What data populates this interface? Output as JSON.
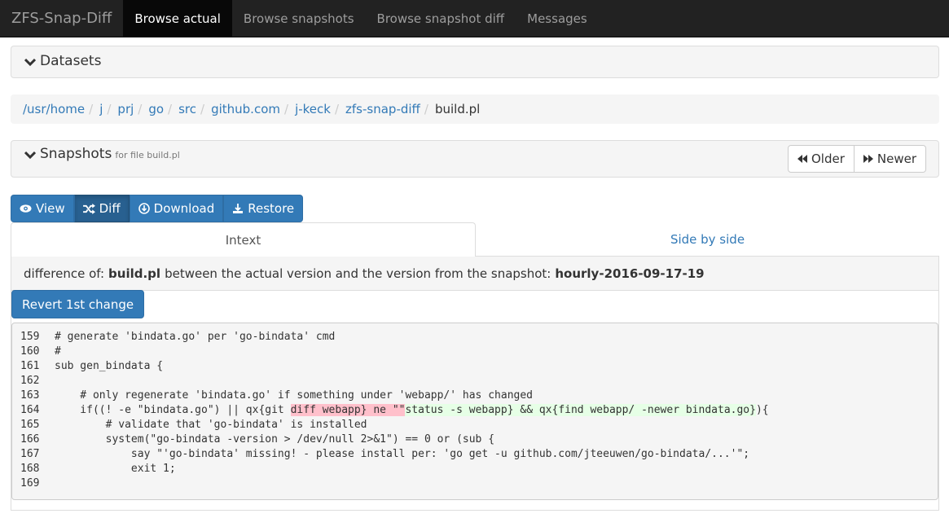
{
  "navbar": {
    "brand": "ZFS-Snap-Diff",
    "items": [
      {
        "label": "Browse actual",
        "active": true
      },
      {
        "label": "Browse snapshots",
        "active": false
      },
      {
        "label": "Browse snapshot diff",
        "active": false
      },
      {
        "label": "Messages",
        "active": false
      }
    ]
  },
  "datasets": {
    "title": "Datasets",
    "icon": "chevron-down-icon"
  },
  "breadcrumb": [
    "/usr/home",
    "j",
    "prj",
    "go",
    "src",
    "github.com",
    "j-keck",
    "zfs-snap-diff",
    "build.pl"
  ],
  "snapshots": {
    "title": "Snapshots",
    "subtitle": "for file build.pl",
    "older_label": "Older",
    "newer_label": "Newer"
  },
  "actions": {
    "view_label": "View",
    "diff_label": "Diff",
    "download_label": "Download",
    "restore_label": "Restore"
  },
  "tabs": [
    {
      "label": "Intext",
      "active": true
    },
    {
      "label": "Side by side",
      "active": false
    }
  ],
  "diff": {
    "prefix": "difference of:",
    "file": "build.pl",
    "middle": "between the actual version and the version from the snapshot:",
    "snapshot": "hourly-2016-09-17-19",
    "revert_label": "Revert 1st change",
    "lines": [
      {
        "num": "159",
        "parts": [
          {
            "text": "# generate 'bindata.go' per 'go-bindata' cmd",
            "type": "normal"
          }
        ]
      },
      {
        "num": "160",
        "parts": [
          {
            "text": "#",
            "type": "normal"
          }
        ]
      },
      {
        "num": "161",
        "parts": [
          {
            "text": "sub gen_bindata {",
            "type": "normal"
          }
        ]
      },
      {
        "num": "162",
        "parts": [
          {
            "text": "",
            "type": "normal"
          }
        ]
      },
      {
        "num": "163",
        "parts": [
          {
            "text": "    # only regenerate 'bindata.go' if something under 'webapp/' has changed",
            "type": "normal"
          }
        ]
      },
      {
        "num": "164",
        "parts": [
          {
            "text": "    if((! -e \"bindata.go\") || qx{git ",
            "type": "normal"
          },
          {
            "text": "diff webapp} ne \"\"",
            "type": "del"
          },
          {
            "text": "status -s webapp} && qx{find webapp/ -newer bindata.go}",
            "type": "ins"
          },
          {
            "text": "){",
            "type": "normal"
          }
        ]
      },
      {
        "num": "165",
        "parts": [
          {
            "text": "        # validate that 'go-bindata' is installed",
            "type": "normal"
          }
        ]
      },
      {
        "num": "166",
        "parts": [
          {
            "text": "        system(\"go-bindata -version > /dev/null 2>&1\") == 0 or (sub {",
            "type": "normal"
          }
        ]
      },
      {
        "num": "167",
        "parts": [
          {
            "text": "            say \"'go-bindata' missing! - please install per: 'go get -u github.com/jteeuwen/go-bindata/...'\";",
            "type": "normal"
          }
        ]
      },
      {
        "num": "168",
        "parts": [
          {
            "text": "            exit 1;",
            "type": "normal"
          }
        ]
      },
      {
        "num": "169",
        "parts": [
          {
            "text": "",
            "type": "normal"
          }
        ]
      }
    ]
  },
  "colors": {
    "accent": "#337ab7",
    "navbar": "#222222",
    "deleted": "#ffc0cb",
    "inserted": "#e6ffe6"
  }
}
